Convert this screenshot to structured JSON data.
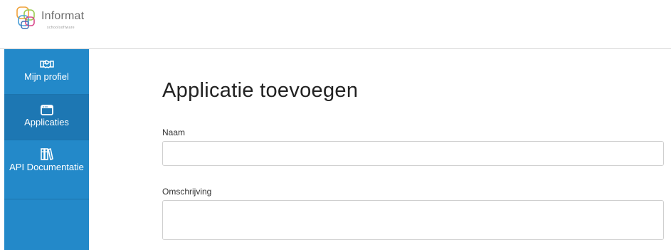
{
  "header": {
    "logo_text": "Informat",
    "logo_subtext": "schoolsoftware"
  },
  "sidebar": {
    "items": [
      {
        "label": "Mijn profiel",
        "icon": "handshake-icon",
        "active": false
      },
      {
        "label": "Applicaties",
        "icon": "browser-window-icon",
        "active": true
      },
      {
        "label": "API Documentatie",
        "icon": "books-icon",
        "active": false
      }
    ]
  },
  "main": {
    "title": "Applicatie toevoegen",
    "fields": [
      {
        "label": "Naam",
        "value": "",
        "placeholder": ""
      },
      {
        "label": "Omschrijving",
        "value": "",
        "placeholder": ""
      }
    ]
  },
  "colors": {
    "sidebar_bg": "#2389c9",
    "sidebar_active": "#1d77b3",
    "logo_orange": "#f0a23a",
    "logo_blue": "#4a9fd8",
    "logo_green": "#9acb4f",
    "logo_pink": "#d9488a"
  }
}
